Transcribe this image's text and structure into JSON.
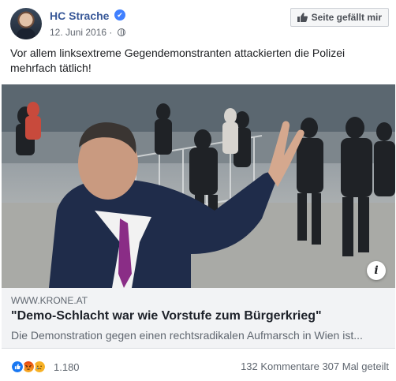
{
  "post": {
    "author": "HC Strache",
    "verified_mark": "✔",
    "date": "12. Juni 2016",
    "separator": "·",
    "like_page_button": "Seite gefällt mir",
    "text": "Vor allem linksextreme Gegendemonstranten attackierten die Polizei mehrfach tätlich!"
  },
  "link_preview": {
    "domain": "WWW.KRONE.AT",
    "title": "\"Demo-Schlacht war wie Vorstufe zum Bürgerkrieg\"",
    "description": "Die Demonstration gegen einen rechtsradikalen Aufmarsch in Wien ist...",
    "info_glyph": "i"
  },
  "footer": {
    "reaction_count": "1.180",
    "comments": "132 Kommentare",
    "shares": "307 Mal geteilt"
  },
  "icons": {
    "reactions": [
      "like-icon",
      "angry-icon",
      "sad-icon"
    ],
    "header": [
      "verified-icon",
      "globe-icon",
      "thumbs-up-icon"
    ]
  },
  "colors": {
    "author_link": "#385898",
    "like_reaction": "#1877f2",
    "angry_reaction": "#e9710f",
    "sad_reaction": "#f7b125",
    "preview_bg": "#f2f3f5"
  }
}
